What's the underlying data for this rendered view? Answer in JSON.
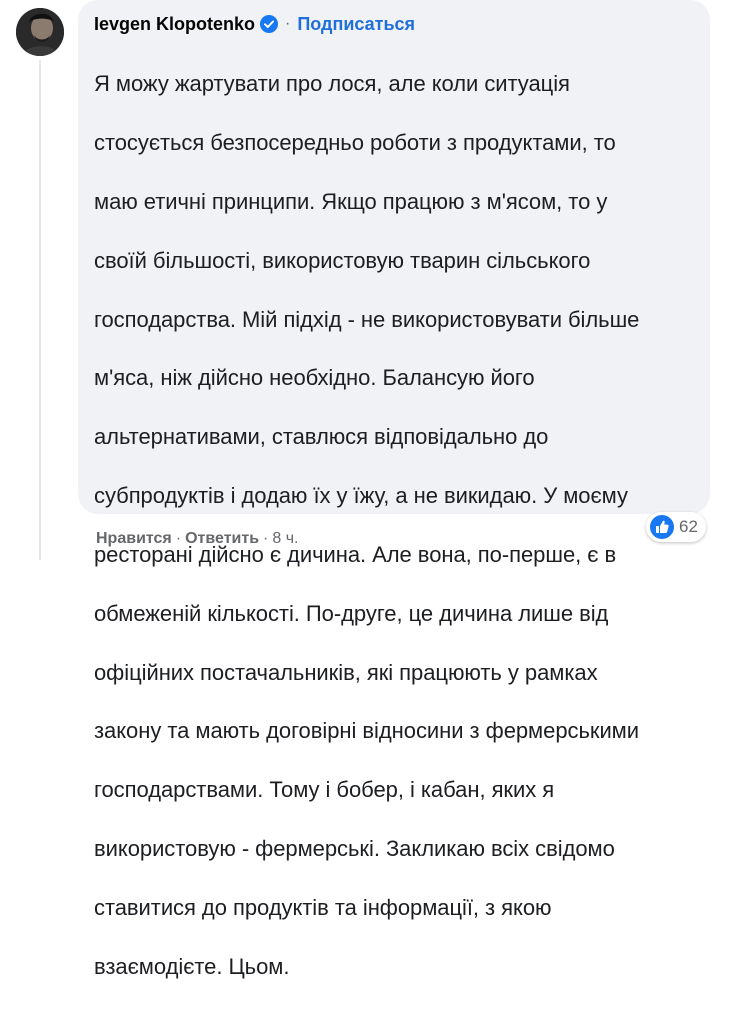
{
  "comment": {
    "author": "Ievgen Klopotenko",
    "separator": "·",
    "follow_label": "Подписаться",
    "lines": [
      "Я можу жартувати про лося, але коли ситуація",
      "стосується безпосередньо роботи з продуктами, то",
      "маю етичні принципи. Якщо працюю з м'ясом, то у",
      "своїй більшості, використовую тварин сільського",
      "господарства. Мій підхід - не використовувати більше",
      "м'яса, ніж дійсно необхідно. Балансую його",
      "альтернативами, ставлюся відповідально до",
      "субпродуктів і додаю їх у їжу, а не викидаю. У моєму",
      "ресторані дійсно є дичина. Але вона, по-перше, є в",
      "обмеженій кількості. По-друге, це дичина лише від",
      "офіційних постачальників, які працюють у рамках",
      "закону та мають договірні відносини з фермерськими",
      "господарствами. Тому і бобер, і кабан, яких я",
      "використовую - фермерські. Закликаю всіх свідомо",
      "ставитися до продуктів та інформації, з якою",
      "взаємодієте. Цьом."
    ],
    "reaction_count": "62",
    "icons": {
      "verified": "verified-badge-icon",
      "reaction": "like-icon"
    },
    "colors": {
      "bubble": "#f0f2f5",
      "link": "#216fdb",
      "verified": "#1877f2",
      "meta": "#65676b"
    }
  },
  "actions": {
    "like_label": "Нравится",
    "reply_label": "Ответить",
    "separator": "·",
    "time": "8 ч."
  }
}
